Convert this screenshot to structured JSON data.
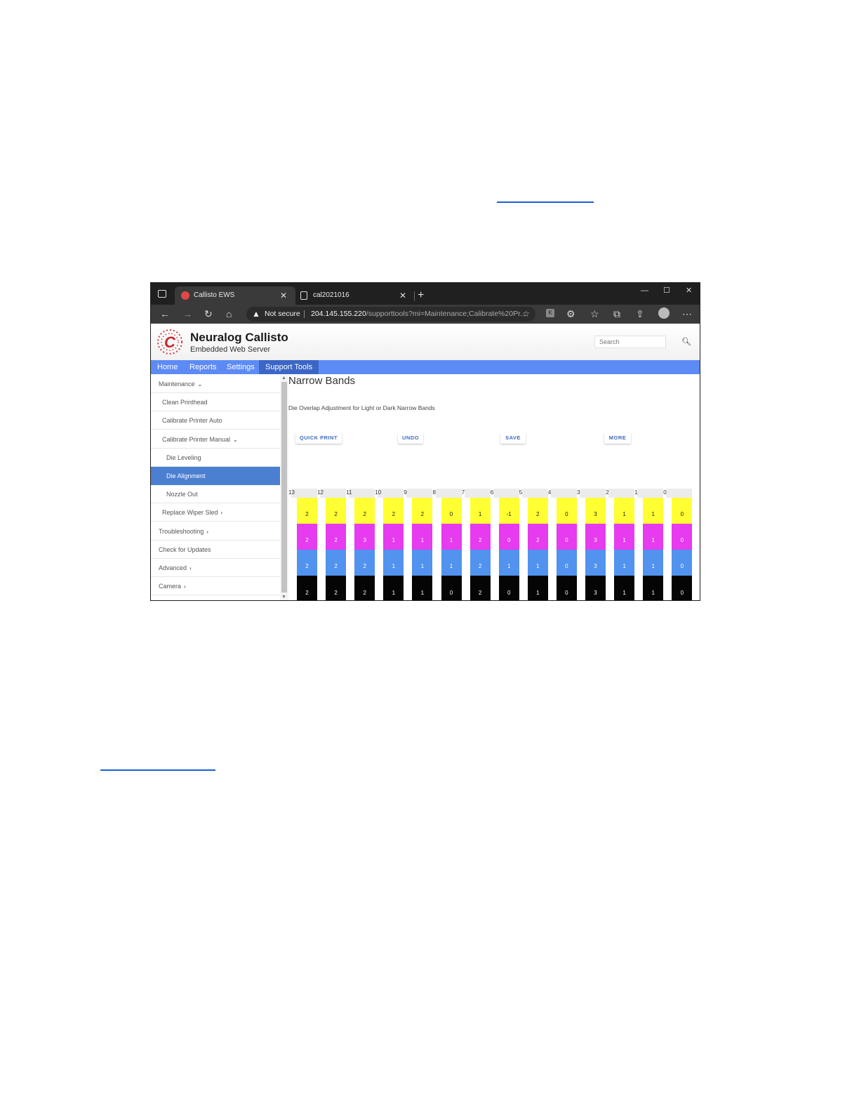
{
  "browser": {
    "tabs": [
      {
        "title": "Callisto EWS",
        "active": true
      },
      {
        "title": "cal2021016",
        "active": false
      }
    ],
    "address": {
      "security_label": "Not secure",
      "url_host": "204.145.155.220",
      "url_path": "/supporttools?mi=Maintenance;Calibrate%20Pr..."
    }
  },
  "app": {
    "brand": "Neuralog Callisto",
    "subtitle": "Embedded Web Server",
    "search_placeholder": "Search",
    "nav": [
      "Home",
      "Reports",
      "Settings",
      "Support Tools"
    ],
    "nav_active": "Support Tools"
  },
  "sidebar": {
    "items": [
      {
        "label": "Maintenance",
        "indent": 0,
        "chevron": "⌄",
        "active": false
      },
      {
        "label": "Clean Printhead",
        "indent": 1,
        "chevron": "",
        "active": false
      },
      {
        "label": "Calibrate Printer Auto",
        "indent": 1,
        "chevron": "",
        "active": false
      },
      {
        "label": "Calibrate Printer Manual",
        "indent": 1,
        "chevron": "⌄",
        "active": false
      },
      {
        "label": "Die Leveling",
        "indent": 2,
        "chevron": "",
        "active": false
      },
      {
        "label": "Die Alignment",
        "indent": 2,
        "chevron": "",
        "active": true
      },
      {
        "label": "Nozzle Out",
        "indent": 2,
        "chevron": "",
        "active": false
      },
      {
        "label": "Replace Wiper Sled",
        "indent": 1,
        "chevron": "›",
        "active": false
      },
      {
        "label": "Troubleshooting",
        "indent": 0,
        "chevron": "›",
        "active": false
      },
      {
        "label": "Check for Updates",
        "indent": 0,
        "chevron": "",
        "active": false
      },
      {
        "label": "Advanced",
        "indent": 0,
        "chevron": "›",
        "active": false
      },
      {
        "label": "Camera",
        "indent": 0,
        "chevron": "›",
        "active": false
      }
    ]
  },
  "main": {
    "title": "Narrow Bands",
    "description": "Die Overlap Adjustment for Light or Dark Narrow Bands",
    "buttons": [
      "QUICK PRINT",
      "UNDO",
      "SAVE",
      "MORE"
    ]
  },
  "die_grid": {
    "columns": [
      {
        "label": "13",
        "yellow": "2",
        "magenta": "2",
        "cyan": "2",
        "black": "2"
      },
      {
        "label": "12",
        "yellow": "2",
        "magenta": "2",
        "cyan": "2",
        "black": "2"
      },
      {
        "label": "11",
        "yellow": "2",
        "magenta": "3",
        "cyan": "2",
        "black": "2"
      },
      {
        "label": "10",
        "yellow": "2",
        "magenta": "1",
        "cyan": "1",
        "black": "1"
      },
      {
        "label": "9",
        "yellow": "2",
        "magenta": "1",
        "cyan": "1",
        "black": "1"
      },
      {
        "label": "8",
        "yellow": "0",
        "magenta": "1",
        "cyan": "1",
        "black": "0"
      },
      {
        "label": "7",
        "yellow": "1",
        "magenta": "2",
        "cyan": "2",
        "black": "2"
      },
      {
        "label": "6",
        "yellow": "-1",
        "magenta": "0",
        "cyan": "1",
        "black": "0"
      },
      {
        "label": "5",
        "yellow": "2",
        "magenta": "2",
        "cyan": "1",
        "black": "1"
      },
      {
        "label": "4",
        "yellow": "0",
        "magenta": "0",
        "cyan": "0",
        "black": "0"
      },
      {
        "label": "3",
        "yellow": "3",
        "magenta": "3",
        "cyan": "3",
        "black": "3"
      },
      {
        "label": "2",
        "yellow": "1",
        "magenta": "1",
        "cyan": "1",
        "black": "1"
      },
      {
        "label": "1",
        "yellow": "1",
        "magenta": "1",
        "cyan": "1",
        "black": "1"
      },
      {
        "label": "0",
        "yellow": "0",
        "magenta": "0",
        "cyan": "0",
        "black": "0"
      }
    ],
    "colors": {
      "yellow": "#ffff33",
      "magenta": "#e63bef",
      "cyan": "#5193ee",
      "black": "#050505"
    }
  }
}
